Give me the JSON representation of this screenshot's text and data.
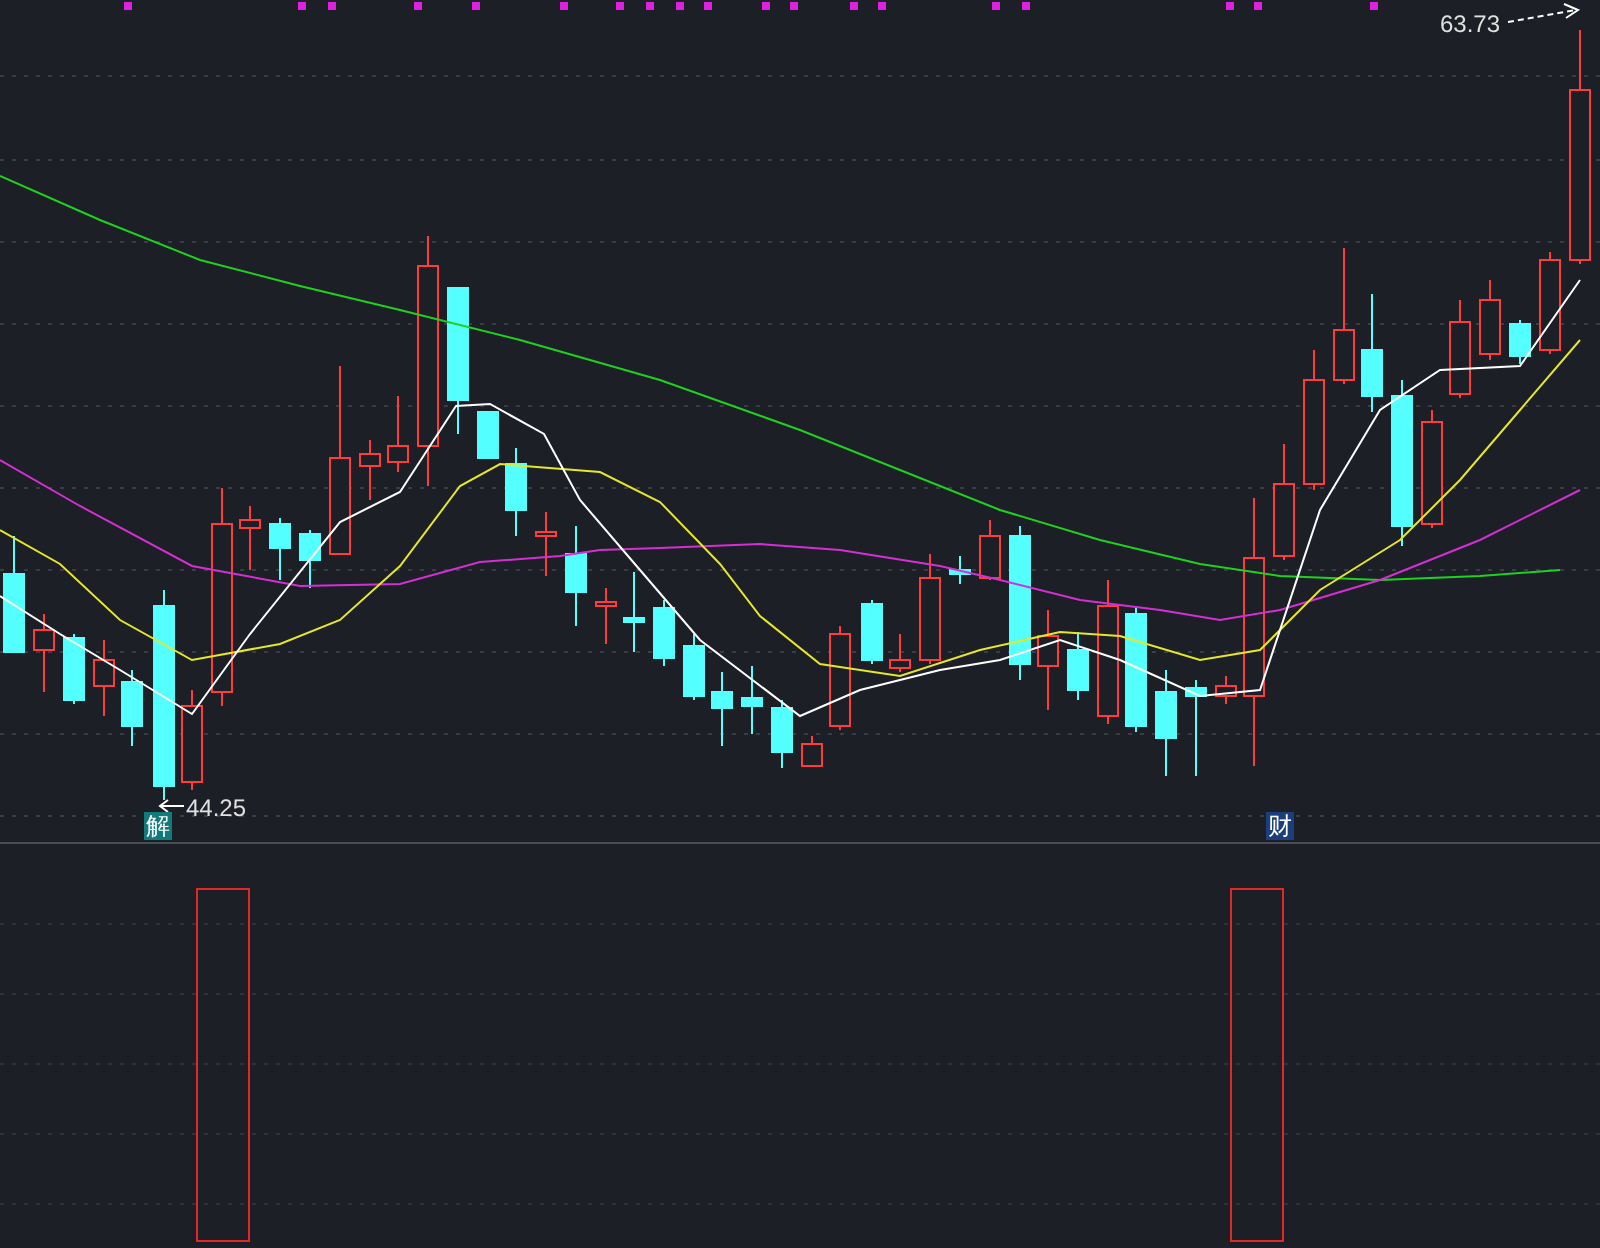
{
  "price_chart": {
    "high_label": "63.73",
    "low_label": "44.25",
    "signals": [
      {
        "text": "解",
        "kind": "unlock"
      },
      {
        "text": "财",
        "kind": "finance"
      }
    ]
  }
}
